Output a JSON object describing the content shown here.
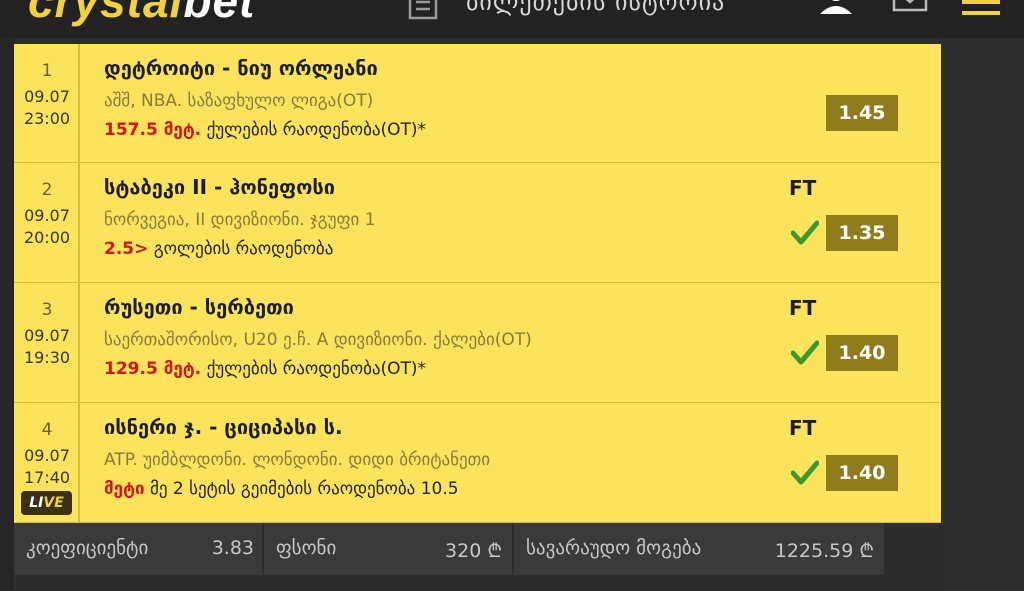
{
  "header": {
    "logo_text": "crystal",
    "logo_text_bold": "bet",
    "title": "ბილეთების ისტორია"
  },
  "colors": {
    "row_bg": "#fbe35c",
    "odd_bg": "#8f7c1d",
    "pick_red": "#d4141a",
    "check_green": "#3a9a2c"
  },
  "bets": [
    {
      "index": "1",
      "date": "09.07",
      "time": "23:00",
      "title": "დეტროიტი - ნიუ ორლეანი",
      "league": "აშშ, NBA. საზაფხულო ლიგა(OT)",
      "pick": "157.5 მეტ.",
      "market": "ქულების რაოდენობა(OT)*",
      "status": "",
      "odd": "1.45",
      "won": false,
      "live": false
    },
    {
      "index": "2",
      "date": "09.07",
      "time": "20:00",
      "title": "სტაბეკი II - ჰონეფოსი",
      "league": "ნორვეგია, II დივიზიონი. ჯგუფი 1",
      "pick": "2.5>",
      "market": "გოლების რაოდენობა",
      "status": "FT",
      "odd": "1.35",
      "won": true,
      "live": false
    },
    {
      "index": "3",
      "date": "09.07",
      "time": "19:30",
      "title": "რუსეთი - სერბეთი",
      "league": "საერთაშორისო, U20 ე.ჩ. A დივიზიონი. ქალები(OT)",
      "pick": "129.5 მეტ.",
      "market": "ქულების რაოდენობა(OT)*",
      "status": "FT",
      "odd": "1.40",
      "won": true,
      "live": false
    },
    {
      "index": "4",
      "date": "09.07",
      "time": "17:40",
      "title": "ისნერი ჯ. - ციციპასი ს.",
      "league": "ATP. უიმბლდონი. ლონდონი. დიდი ბრიტანეთი",
      "pick": "მეტი",
      "market": "მე 2 სეტის გეიმების რაოდენობა 10.5",
      "status": "FT",
      "odd": "1.40",
      "won": true,
      "live": true,
      "live_text_a": "LI",
      "live_text_b": "VE"
    }
  ],
  "footer": {
    "coef_label": "კოეფიციენტი",
    "coef_value": "3.83",
    "stake_label": "ფსონი",
    "stake_value": "320 ₾",
    "win_label": "სავარაუდო მოგება",
    "win_value": "1225.59 ₾"
  }
}
